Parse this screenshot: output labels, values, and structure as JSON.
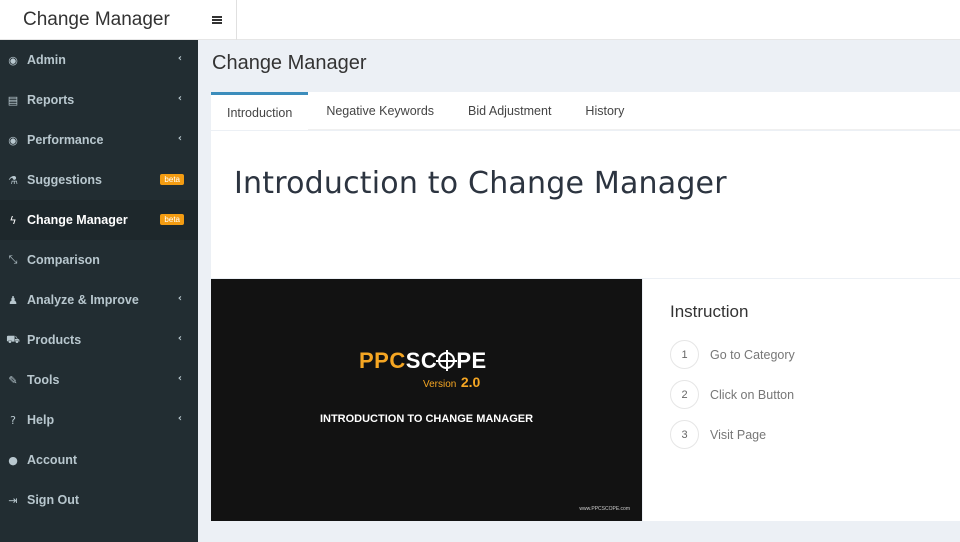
{
  "app": {
    "title": "Change Manager"
  },
  "sidebar": {
    "items": [
      {
        "label": "Admin",
        "icon": "dashboard-icon",
        "glyph": "◉",
        "chevron": true
      },
      {
        "label": "Reports",
        "icon": "book-icon",
        "glyph": "▤",
        "chevron": true
      },
      {
        "label": "Performance",
        "icon": "dashboard-icon",
        "glyph": "◉",
        "chevron": true
      },
      {
        "label": "Suggestions",
        "icon": "flask-icon",
        "glyph": "⚗",
        "badge": "beta"
      },
      {
        "label": "Change Manager",
        "icon": "bolt-icon",
        "glyph": "ϟ",
        "badge": "beta",
        "active": true
      },
      {
        "label": "Comparison",
        "icon": "compress-icon",
        "glyph": "⤡"
      },
      {
        "label": "Analyze & Improve",
        "icon": "user-tie-icon",
        "glyph": "♟",
        "chevron": true
      },
      {
        "label": "Products",
        "icon": "cart-icon",
        "glyph": "⛟",
        "chevron": true
      },
      {
        "label": "Tools",
        "icon": "wrench-icon",
        "glyph": "✎",
        "chevron": true
      },
      {
        "label": "Help",
        "icon": "question-icon",
        "glyph": "?",
        "chevron": true
      },
      {
        "label": "Account",
        "icon": "user-icon",
        "glyph": "●"
      },
      {
        "label": "Sign Out",
        "icon": "sign-out-icon",
        "glyph": "⇥"
      }
    ]
  },
  "content": {
    "title": "Change Manager",
    "tabs": [
      {
        "label": "Introduction",
        "active": true
      },
      {
        "label": "Negative Keywords"
      },
      {
        "label": "Bid Adjustment"
      },
      {
        "label": "History"
      }
    ],
    "heading": "Introduction to Change Manager"
  },
  "video": {
    "logo_ppc": "PPC",
    "logo_s": "SC",
    "logo_pe": "PE",
    "version_label": "Version",
    "version_number": "2.0",
    "title": "INTRODUCTION TO CHANGE MANAGER",
    "url": "www.PPCSCOPE.com"
  },
  "instruction": {
    "title": "Instruction",
    "steps": [
      {
        "num": "1",
        "label": "Go to Category"
      },
      {
        "num": "2",
        "label": "Click on Button"
      },
      {
        "num": "3",
        "label": "Visit Page"
      }
    ]
  },
  "colors": {
    "sidebar_bg": "#222d32",
    "accent": "#3c8dbc",
    "badge": "#f39c12",
    "logo_orange": "#f5a623"
  }
}
